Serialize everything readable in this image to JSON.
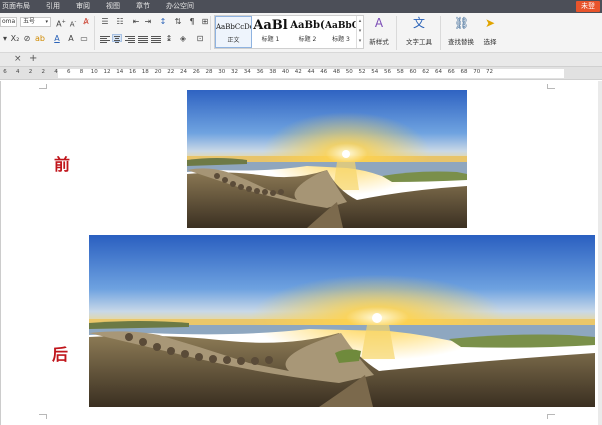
{
  "menu": {
    "items": [
      "页面布局",
      "引用",
      "审阅",
      "视图",
      "章节",
      "办公空间"
    ],
    "login": "未登"
  },
  "ribbon": {
    "font_name": "oma",
    "font_size": "五号",
    "styles": [
      {
        "preview": "AaBbCcDd",
        "name": "正文"
      },
      {
        "preview": "AaBl",
        "name": "标题 1"
      },
      {
        "preview": "AaBb(",
        "name": "标题 2"
      },
      {
        "preview": "AaBbC",
        "name": "标题 3"
      }
    ],
    "new_style": "新样式",
    "text_tools": "文字工具",
    "find_replace": "查找替换",
    "select": "选择"
  },
  "tabs": {
    "close": "×",
    "add": "+"
  },
  "ruler": {
    "numbers": [
      "6",
      "4",
      "2",
      "2",
      "4",
      "6",
      "8",
      "10",
      "12",
      "14",
      "16",
      "18",
      "20",
      "22",
      "24",
      "26",
      "28",
      "30",
      "32",
      "34",
      "36",
      "38",
      "40",
      "42",
      "44",
      "46",
      "48",
      "50",
      "52",
      "54",
      "56",
      "58",
      "60",
      "62",
      "64",
      "66",
      "68",
      "70",
      "72"
    ]
  },
  "document": {
    "label_before": "前",
    "label_after": "后"
  },
  "colors": {
    "label_red": "#c0151b",
    "menubar": "#4c4f58",
    "login_orange": "#e8542b"
  }
}
